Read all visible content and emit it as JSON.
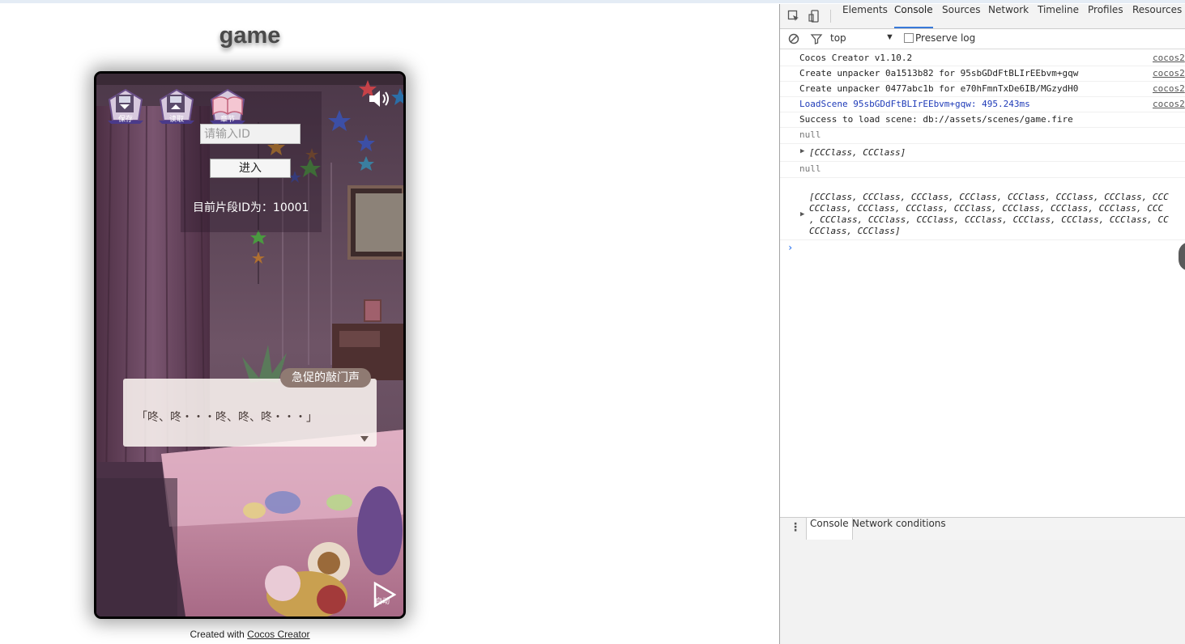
{
  "page": {
    "title": "game",
    "credit_prefix": "Created with",
    "credit_link": "Cocos Creator"
  },
  "game": {
    "buttons": {
      "save": "保存",
      "load": "读取",
      "chapter": "章节",
      "auto": "自动"
    },
    "id_input": {
      "placeholder": "请输入ID",
      "value": ""
    },
    "enter_label": "进入",
    "segment_label": "目前片段ID为：",
    "segment_id": "10001",
    "speaker": "急促的敲门声",
    "dialog": "「咚、咚・・・咚、咚、咚・・・」",
    "icons": [
      "save-icon",
      "load-icon",
      "chapter-book-icon",
      "speaker-sound-icon",
      "auto-play-icon",
      "dialog-next-arrow-icon"
    ]
  },
  "devtools": {
    "tabs": [
      "Elements",
      "Console",
      "Sources",
      "Network",
      "Timeline",
      "Profiles",
      "Resources"
    ],
    "active_tab": "Console",
    "context": "top",
    "preserve_log_label": "Preserve log",
    "preserve_log_checked": false,
    "console": {
      "rows": [
        {
          "text": "Cocos Creator v1.10.2",
          "source": "cocos2",
          "style": "normal"
        },
        {
          "text": "Create unpacker 0a1513b82 for 95sbGDdFtBLIrEEbvm+gqw",
          "source": "cocos2",
          "style": "normal"
        },
        {
          "text": "Create unpacker 0477abc1b for e70hFmnTxDe6IB/MGzydH0",
          "source": "cocos2",
          "style": "normal"
        },
        {
          "text": "LoadScene 95sbGDdFtBLIrEEbvm+gqw: 495.243ms",
          "source": "cocos2",
          "style": "blue"
        },
        {
          "text": "Success to load scene: db://assets/scenes/game.fire",
          "source": "",
          "style": "normal"
        },
        {
          "text": "null",
          "source": "",
          "style": "gray"
        },
        {
          "text": "[CCClass, CCClass]",
          "source": "",
          "style": "italic"
        },
        {
          "text": "null",
          "source": "",
          "style": "gray"
        }
      ],
      "array_lines": [
        "[CCClass, CCClass, CCClass, CCClass, CCClass, CCClass, CCClass, CCC",
        "CCClass, CCClass, CCClass, CCClass, CCClass, CCClass, CCClass, CCC",
        ", CCClass, CCClass, CCClass, CCClass, CCClass, CCClass, CCClass, CC",
        "CCClass, CCClass]"
      ],
      "prompt": "›"
    },
    "drawer_tabs": [
      "Console",
      "Network conditions"
    ],
    "drawer_active": "Console",
    "colors": {
      "tab_underline": "#3879d9",
      "load_scene_text": "#1f3bb8",
      "prompt": "#367cf1"
    }
  }
}
